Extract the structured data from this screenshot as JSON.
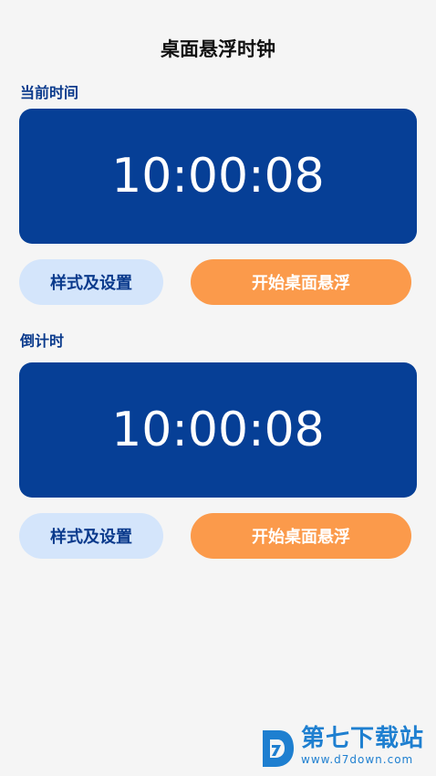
{
  "app": {
    "title": "桌面悬浮时钟"
  },
  "current_time": {
    "label": "当前时间",
    "time": "10:00:08",
    "style_button": "样式及设置",
    "float_button": "开始桌面悬浮"
  },
  "countdown": {
    "label": "倒计时",
    "time": "10:00:08",
    "style_button": "样式及设置",
    "float_button": "开始桌面悬浮"
  },
  "watermark": {
    "name": "第七下载站",
    "url": "www.d7down.com"
  },
  "colors": {
    "background": "#f5f5f5",
    "card": "#063f96",
    "label": "#0a3a8c",
    "style_button_bg": "#d4e5fb",
    "float_button_bg": "#fb9a4b",
    "watermark": "#1e7fd0"
  }
}
